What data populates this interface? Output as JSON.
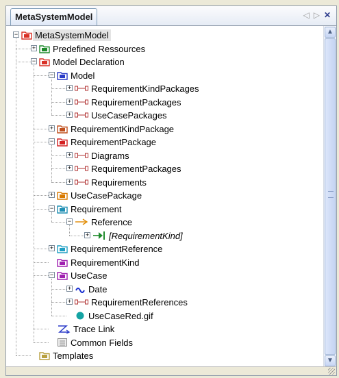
{
  "panel": {
    "tab_title": "MetaSystemModel",
    "nav_icons": [
      "left-arrow-icon",
      "right-arrow-icon",
      "close-icon"
    ]
  },
  "tree": [
    {
      "label": "MetaSystemModel",
      "icon": "folder-icon",
      "color": "#d93025",
      "depth": 0,
      "exp": "-",
      "selected": true
    },
    {
      "label": "Predefined Ressources",
      "icon": "folder-icon",
      "color": "#1e8a2b",
      "depth": 1,
      "exp": "+"
    },
    {
      "label": "Model Declaration",
      "icon": "folder-icon",
      "color": "#d93025",
      "depth": 1,
      "exp": "-"
    },
    {
      "label": "Model",
      "icon": "folder-icon",
      "color": "#2b3cc8",
      "depth": 2,
      "exp": "-"
    },
    {
      "label": "RequirementKindPackages",
      "icon": "association-icon",
      "color": "#b03030",
      "depth": 3,
      "exp": "+"
    },
    {
      "label": "RequirementPackages",
      "icon": "association-icon",
      "color": "#b03030",
      "depth": 3,
      "exp": "+"
    },
    {
      "label": "UseCasePackages",
      "icon": "association-icon",
      "color": "#b03030",
      "depth": 3,
      "exp": "+"
    },
    {
      "label": "RequirementKindPackage",
      "icon": "folder-icon",
      "color": "#c0501e",
      "depth": 2,
      "exp": "+"
    },
    {
      "label": "RequirementPackage",
      "icon": "folder-icon",
      "color": "#d42020",
      "depth": 2,
      "exp": "-"
    },
    {
      "label": "Diagrams",
      "icon": "association-icon",
      "color": "#b03030",
      "depth": 3,
      "exp": "+"
    },
    {
      "label": "RequirementPackages",
      "icon": "association-icon",
      "color": "#b03030",
      "depth": 3,
      "exp": "+"
    },
    {
      "label": "Requirements",
      "icon": "association-icon",
      "color": "#b03030",
      "depth": 3,
      "exp": "+"
    },
    {
      "label": "UseCasePackage",
      "icon": "folder-icon",
      "color": "#d97a00",
      "depth": 2,
      "exp": "+"
    },
    {
      "label": "Requirement",
      "icon": "folder-icon",
      "color": "#1f8fb4",
      "depth": 2,
      "exp": "-"
    },
    {
      "label": "Reference",
      "icon": "reference-arrow-icon",
      "color": "#e08a00",
      "depth": 3,
      "exp": "-"
    },
    {
      "label": "[RequirementKind]",
      "icon": "target-arrow-icon",
      "color": "#1e8a2b",
      "depth": 4,
      "exp": "+",
      "italic": true
    },
    {
      "label": "RequirementReference",
      "icon": "folder-icon",
      "color": "#1f9fc4",
      "depth": 2,
      "exp": "+"
    },
    {
      "label": "RequirementKind",
      "icon": "folder-icon",
      "color": "#a020b0",
      "depth": 2,
      "exp": ""
    },
    {
      "label": "UseCase",
      "icon": "folder-icon",
      "color": "#a020b0",
      "depth": 2,
      "exp": "-"
    },
    {
      "label": "Date",
      "icon": "tilde-icon",
      "color": "#1a2fd0",
      "depth": 3,
      "exp": "+"
    },
    {
      "label": "RequirementReferences",
      "icon": "association-icon",
      "color": "#b03030",
      "depth": 3,
      "exp": "+"
    },
    {
      "label": "UseCaseRed.gif",
      "icon": "circle-icon",
      "color": "#14a3a3",
      "depth": 3,
      "exp": ""
    },
    {
      "label": "Trace Link",
      "icon": "trace-link-icon",
      "color": "#2b3cc8",
      "depth": 2,
      "exp": ""
    },
    {
      "label": "Common Fields",
      "icon": "fields-icon",
      "color": "#888888",
      "depth": 2,
      "exp": ""
    },
    {
      "label": "Templates",
      "icon": "folder-icon",
      "color": "#b8a040",
      "depth": 1,
      "exp": ""
    }
  ],
  "scrollbar": {
    "up_icon": "scroll-up-icon",
    "down_icon": "scroll-down-icon"
  }
}
